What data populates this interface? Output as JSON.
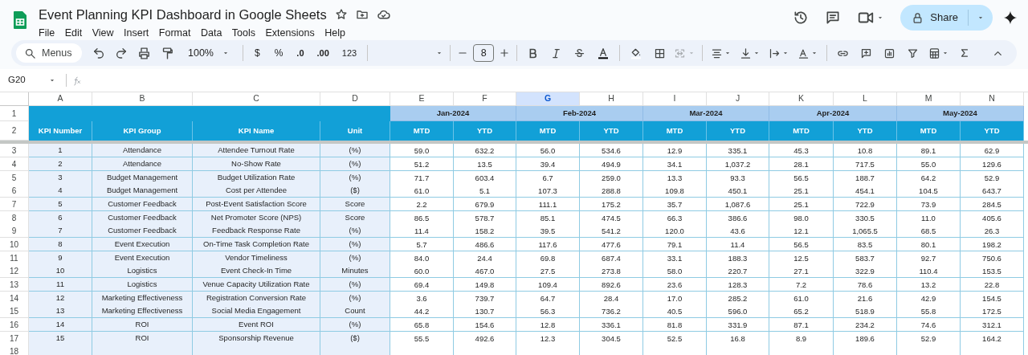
{
  "window": {
    "title": "Event Planning KPI Dashboard in Google Sheets"
  },
  "menu": [
    "File",
    "Edit",
    "View",
    "Insert",
    "Format",
    "Data",
    "Tools",
    "Extensions",
    "Help"
  ],
  "share_button": "Share",
  "toolbar": {
    "search_placeholder": "Menus",
    "zoom": "100%",
    "currency": "$",
    "percent": "%",
    "decrease_decimals": ".0",
    "increase_decimals": ".00",
    "more_formats": "123",
    "font_size": "8"
  },
  "formula_bar": {
    "name_box": "G20"
  },
  "columns": [
    {
      "label": "A",
      "selected": false
    },
    {
      "label": "B",
      "selected": false
    },
    {
      "label": "C",
      "selected": false
    },
    {
      "label": "D",
      "selected": false
    },
    {
      "label": "E",
      "selected": false
    },
    {
      "label": "F",
      "selected": false
    },
    {
      "label": "G",
      "selected": true
    },
    {
      "label": "H",
      "selected": false
    },
    {
      "label": "I",
      "selected": false
    },
    {
      "label": "J",
      "selected": false
    },
    {
      "label": "K",
      "selected": false
    },
    {
      "label": "L",
      "selected": false
    },
    {
      "label": "M",
      "selected": false
    },
    {
      "label": "N",
      "selected": false
    }
  ],
  "row_numbers": [
    "1",
    "2",
    "3",
    "4",
    "5",
    "6",
    "7",
    "8",
    "9",
    "10",
    "11",
    "12",
    "13",
    "14",
    "15",
    "16",
    "17",
    "18"
  ],
  "months": [
    "Jan-2024",
    "Feb-2024",
    "Mar-2024",
    "Apr-2024",
    "May-2024"
  ],
  "headers": [
    "KPI Number",
    "KPI Group",
    "KPI Name",
    "Unit"
  ],
  "period_headers": [
    "MTD",
    "YTD",
    "MTD",
    "YTD",
    "MTD",
    "YTD",
    "MTD",
    "YTD",
    "MTD",
    "YTD"
  ],
  "rows": [
    {
      "number": "1",
      "group": "Attendance",
      "name": "Attendee Turnout Rate",
      "unit": "(%)",
      "values": [
        "59.0",
        "632.2",
        "56.0",
        "534.6",
        "12.9",
        "335.1",
        "45.3",
        "10.8",
        "89.1",
        "62.9"
      ]
    },
    {
      "number": "2",
      "group": "Attendance",
      "name": "No-Show Rate",
      "unit": "(%)",
      "values": [
        "51.2",
        "13.5",
        "39.4",
        "494.9",
        "34.1",
        "1,037.2",
        "28.1",
        "717.5",
        "55.0",
        "129.6"
      ]
    },
    {
      "number": "3",
      "group": "Budget Management",
      "name": "Budget Utilization Rate",
      "unit": "(%)",
      "values": [
        "71.7",
        "603.4",
        "6.7",
        "259.0",
        "13.3",
        "93.3",
        "56.5",
        "188.7",
        "64.2",
        "52.9"
      ]
    },
    {
      "number": "4",
      "group": "Budget Management",
      "name": "Cost per Attendee",
      "unit": "($)",
      "values": [
        "61.0",
        "5.1",
        "107.3",
        "288.8",
        "109.8",
        "450.1",
        "25.1",
        "454.1",
        "104.5",
        "643.7"
      ]
    },
    {
      "number": "5",
      "group": "Customer Feedback",
      "name": "Post-Event Satisfaction Score",
      "unit": "Score",
      "values": [
        "2.2",
        "679.9",
        "111.1",
        "175.2",
        "35.7",
        "1,087.6",
        "25.1",
        "722.9",
        "73.9",
        "284.5"
      ]
    },
    {
      "number": "6",
      "group": "Customer Feedback",
      "name": "Net Promoter Score (NPS)",
      "unit": "Score",
      "values": [
        "86.5",
        "578.7",
        "85.1",
        "474.5",
        "66.3",
        "386.6",
        "98.0",
        "330.5",
        "11.0",
        "405.6"
      ]
    },
    {
      "number": "7",
      "group": "Customer Feedback",
      "name": "Feedback Response Rate",
      "unit": "(%)",
      "values": [
        "11.4",
        "158.2",
        "39.5",
        "541.2",
        "120.0",
        "43.6",
        "12.1",
        "1,065.5",
        "68.5",
        "26.3"
      ]
    },
    {
      "number": "8",
      "group": "Event Execution",
      "name": "On-Time Task Completion Rate",
      "unit": "(%)",
      "values": [
        "5.7",
        "486.6",
        "117.6",
        "477.6",
        "79.1",
        "11.4",
        "56.5",
        "83.5",
        "80.1",
        "198.2"
      ]
    },
    {
      "number": "9",
      "group": "Event Execution",
      "name": "Vendor Timeliness",
      "unit": "(%)",
      "values": [
        "84.0",
        "24.4",
        "69.8",
        "687.4",
        "33.1",
        "188.3",
        "12.5",
        "583.7",
        "92.7",
        "750.6"
      ]
    },
    {
      "number": "10",
      "group": "Logistics",
      "name": "Event Check-In Time",
      "unit": "Minutes",
      "values": [
        "60.0",
        "467.0",
        "27.5",
        "273.8",
        "58.0",
        "220.7",
        "27.1",
        "322.9",
        "110.4",
        "153.5"
      ]
    },
    {
      "number": "11",
      "group": "Logistics",
      "name": "Venue Capacity Utilization Rate",
      "unit": "(%)",
      "values": [
        "69.4",
        "149.8",
        "109.4",
        "892.6",
        "23.6",
        "128.3",
        "7.2",
        "78.6",
        "13.2",
        "22.8"
      ]
    },
    {
      "number": "12",
      "group": "Marketing Effectiveness",
      "name": "Registration Conversion Rate",
      "unit": "(%)",
      "values": [
        "3.6",
        "739.7",
        "64.7",
        "28.4",
        "17.0",
        "285.2",
        "61.0",
        "21.6",
        "42.9",
        "154.5"
      ]
    },
    {
      "number": "13",
      "group": "Marketing Effectiveness",
      "name": "Social Media Engagement",
      "unit": "Count",
      "values": [
        "44.2",
        "130.7",
        "56.3",
        "736.2",
        "40.5",
        "596.0",
        "65.2",
        "518.9",
        "55.8",
        "172.5"
      ]
    },
    {
      "number": "14",
      "group": "ROI",
      "name": "Event ROI",
      "unit": "(%)",
      "values": [
        "65.8",
        "154.6",
        "12.8",
        "336.1",
        "81.8",
        "331.9",
        "87.1",
        "234.2",
        "74.6",
        "312.1"
      ]
    },
    {
      "number": "15",
      "group": "ROI",
      "name": "Sponsorship Revenue",
      "unit": "($)",
      "values": [
        "55.5",
        "492.6",
        "12.3",
        "304.5",
        "52.5",
        "16.8",
        "8.9",
        "189.6",
        "52.9",
        "164.2"
      ]
    }
  ]
}
